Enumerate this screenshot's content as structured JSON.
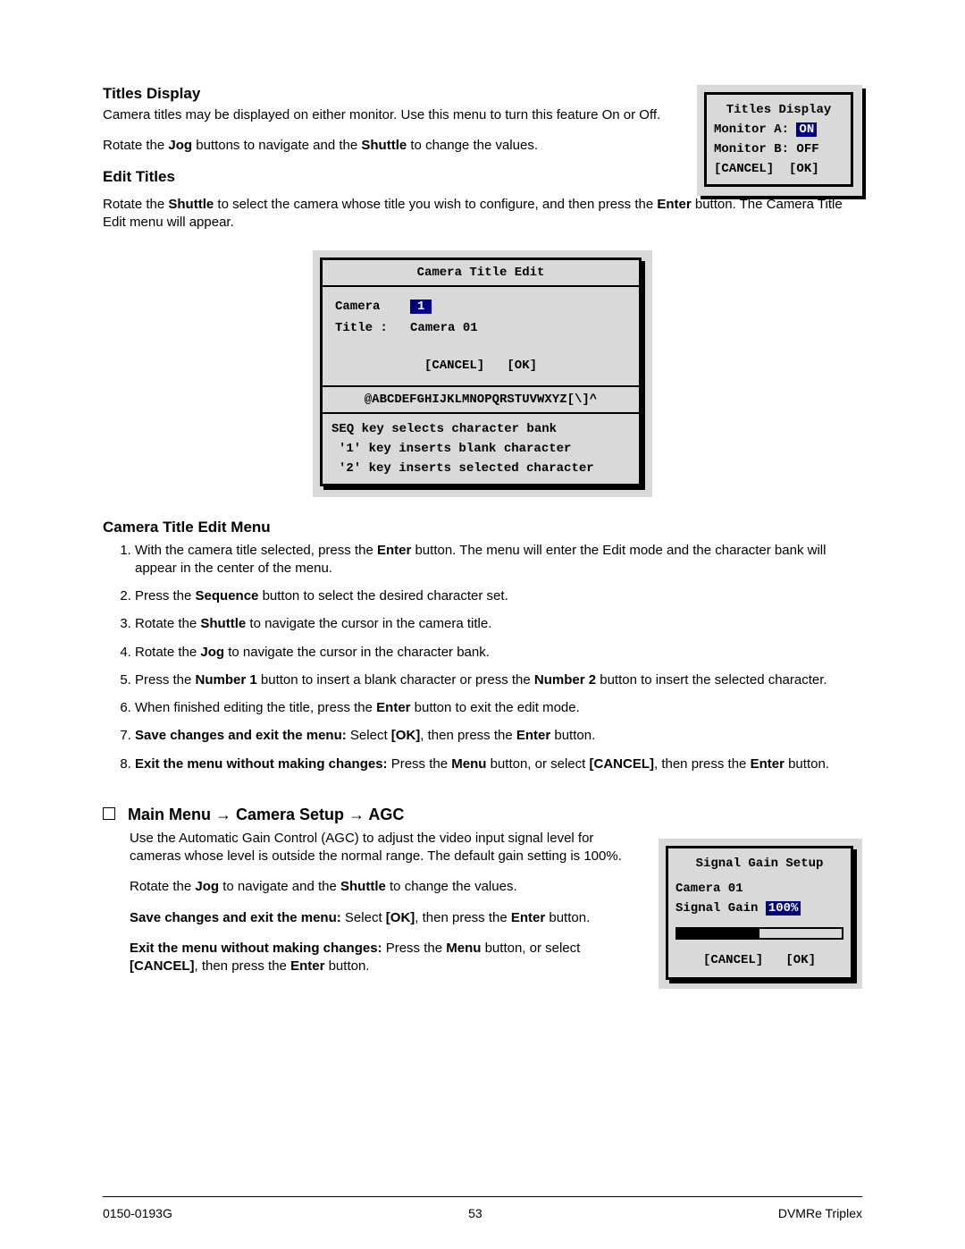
{
  "titles_display": {
    "heading": "Titles Display",
    "p1": "Camera titles may be displayed on either monitor.  Use this menu to turn this feature On or Off.",
    "p2_pre": "Rotate the ",
    "p2_jog": "Jog",
    "p2_mid": " buttons to navigate and the ",
    "p2_shuttle": "Shuttle",
    "p2_post": " to change the values."
  },
  "titles_osd": {
    "title": "Titles Display",
    "monA_label": "Monitor A:",
    "monA_val": "ON",
    "monB_label": "Monitor B:",
    "monB_val": "OFF",
    "cancel": "[CANCEL]",
    "ok": "[OK]"
  },
  "edit_titles": {
    "heading": "Edit Titles",
    "p_pre": "Rotate the ",
    "shuttle": "Shuttle",
    "p_mid": " to select the camera whose title you wish to configure, and then press the ",
    "enter": "Enter",
    "p_post": " button. The Camera Title Edit menu will appear."
  },
  "cte_osd": {
    "title": "Camera Title Edit",
    "camera_label": "Camera",
    "camera_val": "1",
    "title_label": "Title :",
    "title_val": "Camera 01",
    "cancel": "[CANCEL]",
    "ok": "[OK]",
    "charbank": "@ABCDEFGHIJKLMNOPQRSTUVWXYZ[\\]^",
    "help1": "SEQ key selects character bank",
    "help2": "'1' key inserts blank character",
    "help3": "'2' key inserts selected character"
  },
  "cte_section": {
    "heading": "Camera Title Edit Menu",
    "s1_pre": "With the camera title selected, press the ",
    "s1_enter": "Enter",
    "s1_post": " button.  The menu will enter the Edit mode and the character bank will appear in the center of the menu.",
    "s2_pre": "Press the ",
    "s2_seq": "Sequence",
    "s2_post": " button to select the desired character set.",
    "s3_pre": "Rotate the ",
    "s3_sh": "Shuttle",
    "s3_post": " to navigate the cursor in the camera title.",
    "s4_pre": "Rotate the ",
    "s4_jog": "Jog",
    "s4_post": " to navigate the cursor in the character bank.",
    "s5_pre": "Press the ",
    "s5_n1": "Number 1",
    "s5_mid": " button to insert a blank character or press the ",
    "s5_n2": "Number 2",
    "s5_post": " button to insert the selected character.",
    "s6_pre": "When finished editing the title, press the ",
    "s6_enter": "Enter",
    "s6_post": " button to exit the edit mode.",
    "s7_b1": "Save changes and exit the menu:",
    "s7_mid": "  Select ",
    "s7_ok": "[OK]",
    "s7_mid2": ", then press the ",
    "s7_enter": "Enter",
    "s7_post": " button.",
    "s8_b1": "Exit the menu without making changes:",
    "s8_mid": "  Press the ",
    "s8_menu": "Menu",
    "s8_mid2": " button, or select ",
    "s8_cancel": "[CANCEL]",
    "s8_mid3": ", then press the ",
    "s8_enter": "Enter",
    "s8_post": " button."
  },
  "agc": {
    "heading_pre": "Main Menu ",
    "heading_mid": " Camera Setup ",
    "heading_post": " AGC",
    "arrow": "→",
    "p1": "Use the Automatic Gain Control (AGC) to adjust the video input signal level for cameras whose level is outside the normal range. The default gain setting is 100%.",
    "p2_pre": "Rotate the ",
    "p2_jog": "Jog",
    "p2_mid": " to navigate and the ",
    "p2_sh": "Shuttle",
    "p2_post": " to change the values.",
    "p3_b": "Save changes and exit the menu:",
    "p3_mid": "  Select ",
    "p3_ok": "[OK]",
    "p3_mid2": ", then press the ",
    "p3_enter": "Enter",
    "p3_post": " button.",
    "p4_b": "Exit the menu without making changes:",
    "p4_mid": "  Press the ",
    "p4_menu": "Menu",
    "p4_mid2": " button, or select ",
    "p4_cancel": "[CANCEL]",
    "p4_mid3": ", then press the ",
    "p4_enter": "Enter",
    "p4_post": " button."
  },
  "sg_osd": {
    "title": "Signal Gain Setup",
    "camera": "Camera 01",
    "label": "Signal Gain",
    "value": "100%",
    "cancel": "[CANCEL]",
    "ok": "[OK]"
  },
  "footer": {
    "left": "0150-0193G",
    "center": "53",
    "right": "DVMRe Triplex"
  }
}
